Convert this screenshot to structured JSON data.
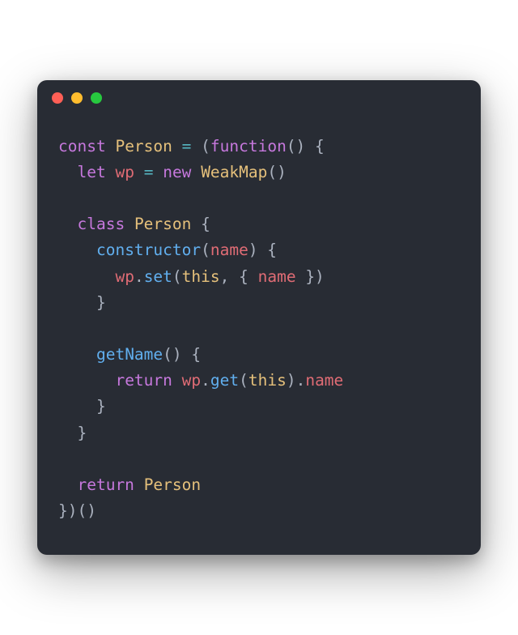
{
  "tokens": [
    [
      {
        "t": "const",
        "c": "kw"
      },
      {
        "t": " ",
        "c": "pun"
      },
      {
        "t": "Person",
        "c": "cls"
      },
      {
        "t": " ",
        "c": "pun"
      },
      {
        "t": "=",
        "c": "op"
      },
      {
        "t": " (",
        "c": "pun"
      },
      {
        "t": "function",
        "c": "kw"
      },
      {
        "t": "() {",
        "c": "pun"
      }
    ],
    [
      {
        "t": "  ",
        "c": "pun"
      },
      {
        "t": "let",
        "c": "kw"
      },
      {
        "t": " ",
        "c": "pun"
      },
      {
        "t": "wp",
        "c": "var"
      },
      {
        "t": " ",
        "c": "pun"
      },
      {
        "t": "=",
        "c": "op"
      },
      {
        "t": " ",
        "c": "pun"
      },
      {
        "t": "new",
        "c": "kw"
      },
      {
        "t": " ",
        "c": "pun"
      },
      {
        "t": "WeakMap",
        "c": "cls"
      },
      {
        "t": "()",
        "c": "pun"
      }
    ],
    [],
    [
      {
        "t": "  ",
        "c": "pun"
      },
      {
        "t": "class",
        "c": "kw"
      },
      {
        "t": " ",
        "c": "pun"
      },
      {
        "t": "Person",
        "c": "cls"
      },
      {
        "t": " {",
        "c": "pun"
      }
    ],
    [
      {
        "t": "    ",
        "c": "pun"
      },
      {
        "t": "constructor",
        "c": "fn"
      },
      {
        "t": "(",
        "c": "pun"
      },
      {
        "t": "name",
        "c": "var"
      },
      {
        "t": ") {",
        "c": "pun"
      }
    ],
    [
      {
        "t": "      ",
        "c": "pun"
      },
      {
        "t": "wp",
        "c": "var"
      },
      {
        "t": ".",
        "c": "pun"
      },
      {
        "t": "set",
        "c": "fn"
      },
      {
        "t": "(",
        "c": "pun"
      },
      {
        "t": "this",
        "c": "this"
      },
      {
        "t": ", { ",
        "c": "pun"
      },
      {
        "t": "name",
        "c": "var"
      },
      {
        "t": " })",
        "c": "pun"
      }
    ],
    [
      {
        "t": "    }",
        "c": "pun"
      }
    ],
    [],
    [
      {
        "t": "    ",
        "c": "pun"
      },
      {
        "t": "getName",
        "c": "fn"
      },
      {
        "t": "() {",
        "c": "pun"
      }
    ],
    [
      {
        "t": "      ",
        "c": "pun"
      },
      {
        "t": "return",
        "c": "kw"
      },
      {
        "t": " ",
        "c": "pun"
      },
      {
        "t": "wp",
        "c": "var"
      },
      {
        "t": ".",
        "c": "pun"
      },
      {
        "t": "get",
        "c": "fn"
      },
      {
        "t": "(",
        "c": "pun"
      },
      {
        "t": "this",
        "c": "this"
      },
      {
        "t": ").",
        "c": "pun"
      },
      {
        "t": "name",
        "c": "prop"
      }
    ],
    [
      {
        "t": "    }",
        "c": "pun"
      }
    ],
    [
      {
        "t": "  }",
        "c": "pun"
      }
    ],
    [],
    [
      {
        "t": "  ",
        "c": "pun"
      },
      {
        "t": "return",
        "c": "kw"
      },
      {
        "t": " ",
        "c": "pun"
      },
      {
        "t": "Person",
        "c": "cls"
      }
    ],
    [
      {
        "t": "})()",
        "c": "pun"
      }
    ]
  ]
}
